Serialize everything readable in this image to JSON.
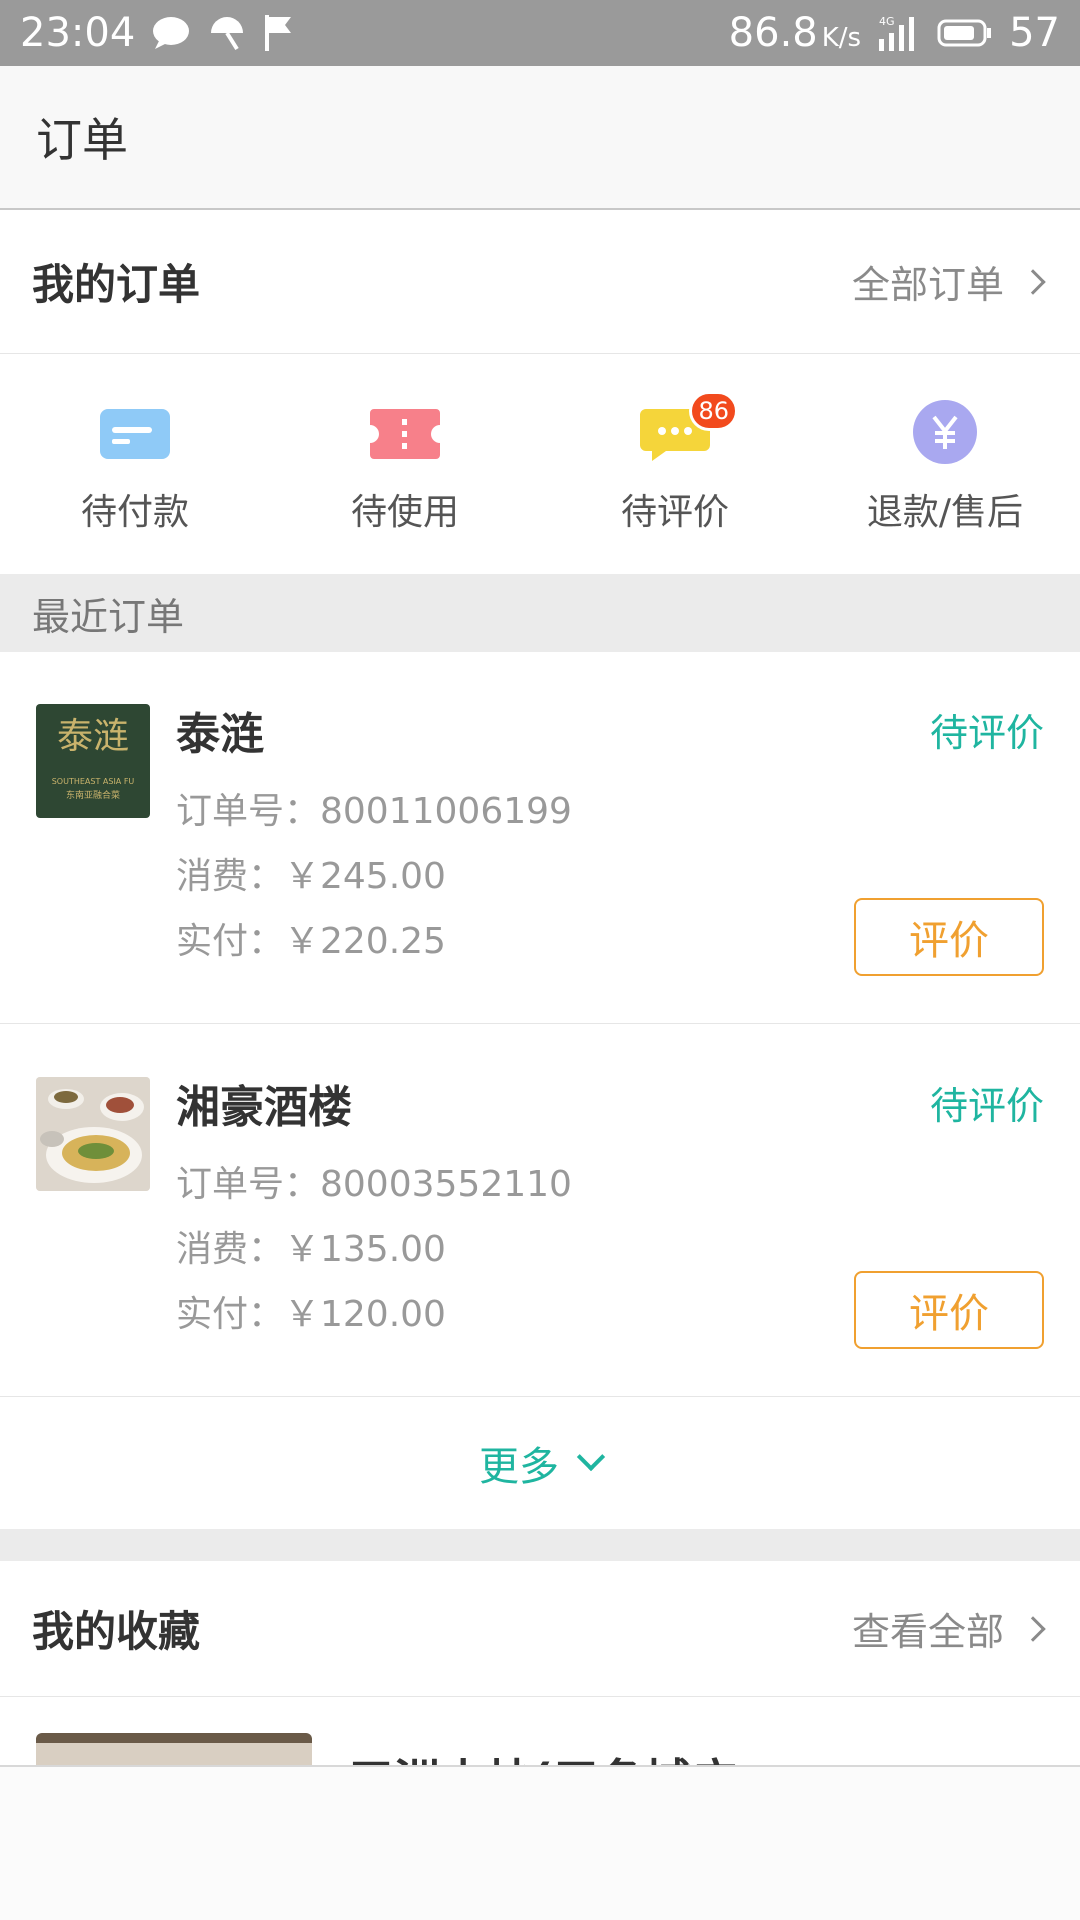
{
  "status_bar": {
    "time": "23:04",
    "network_speed": "86.8",
    "network_unit": "K/s",
    "signal_label": "4G",
    "battery": "57"
  },
  "header": {
    "title": "订单"
  },
  "my_orders": {
    "title": "我的订单",
    "all_link": "全部订单",
    "quick_actions": [
      {
        "label": "待付款",
        "icon": "card-icon",
        "color": "#8fcaf7"
      },
      {
        "label": "待使用",
        "icon": "ticket-icon",
        "color": "#f7808a"
      },
      {
        "label": "待评价",
        "icon": "chat-bubble-icon",
        "color": "#f5d53a",
        "badge": "86"
      },
      {
        "label": "退款/售后",
        "icon": "yen-icon",
        "color": "#a9a8f0"
      }
    ]
  },
  "recent": {
    "title": "最近订单",
    "orders": [
      {
        "name": "泰涟",
        "status": "待评价",
        "order_no": "订单号：80011006199",
        "spend": "消费：￥245.00",
        "paid": "实付：￥220.25",
        "button": "评价",
        "thumb_logo": "泰涟",
        "thumb_sub": "SOUTHEAST ASIA FU",
        "thumb_sub2": "东南亚融合菜"
      },
      {
        "name": "湘豪酒楼",
        "status": "待评价",
        "order_no": "订单号：80003552110",
        "spend": "消费：￥135.00",
        "paid": "实付：￥120.00",
        "button": "评价"
      }
    ],
    "more": "更多"
  },
  "favorites": {
    "title": "我的收藏",
    "all_link": "查看全部",
    "first_item_title": "三洲小炒(三条城广"
  },
  "colors": {
    "accent": "#1fb5a0",
    "button": "#f0a030",
    "badge": "#f24a1d"
  }
}
